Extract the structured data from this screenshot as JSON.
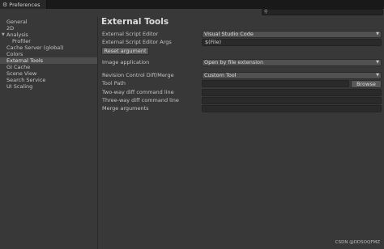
{
  "window": {
    "tab_title": "Preferences"
  },
  "sidebar": {
    "items": [
      {
        "label": "General"
      },
      {
        "label": "2D"
      },
      {
        "label": "Analysis"
      },
      {
        "label": "Profiler"
      },
      {
        "label": "Cache Server (global)"
      },
      {
        "label": "Colors"
      },
      {
        "label": "External Tools"
      },
      {
        "label": "GI Cache"
      },
      {
        "label": "Scene View"
      },
      {
        "label": "Search Service"
      },
      {
        "label": "UI Scaling"
      }
    ]
  },
  "main": {
    "title": "External Tools",
    "script_editor": {
      "label": "External Script Editor",
      "value": "Visual Studio Code"
    },
    "script_editor_args": {
      "label": "External Script Editor Args",
      "value": "$(File)"
    },
    "reset_button": "Reset argument",
    "image_application": {
      "label": "Image application",
      "value": "Open by file extension"
    },
    "revision_control": {
      "label": "Revision Control Diff/Merge",
      "value": "Custom Tool"
    },
    "tool_path": {
      "label": "Tool Path",
      "value": "",
      "browse": "Browse"
    },
    "two_way_diff": {
      "label": "Two-way diff command line",
      "value": ""
    },
    "three_way_diff": {
      "label": "Three-way diff command line",
      "value": ""
    },
    "merge_arguments": {
      "label": "Merge arguments",
      "value": ""
    }
  },
  "watermark": "CSDN @DDSOQFMZ",
  "icons": {
    "tab": "gear-icon",
    "search": "search-icon",
    "dropdown": "caret-down-icon",
    "foldout": "foldout-triangle-icon"
  }
}
